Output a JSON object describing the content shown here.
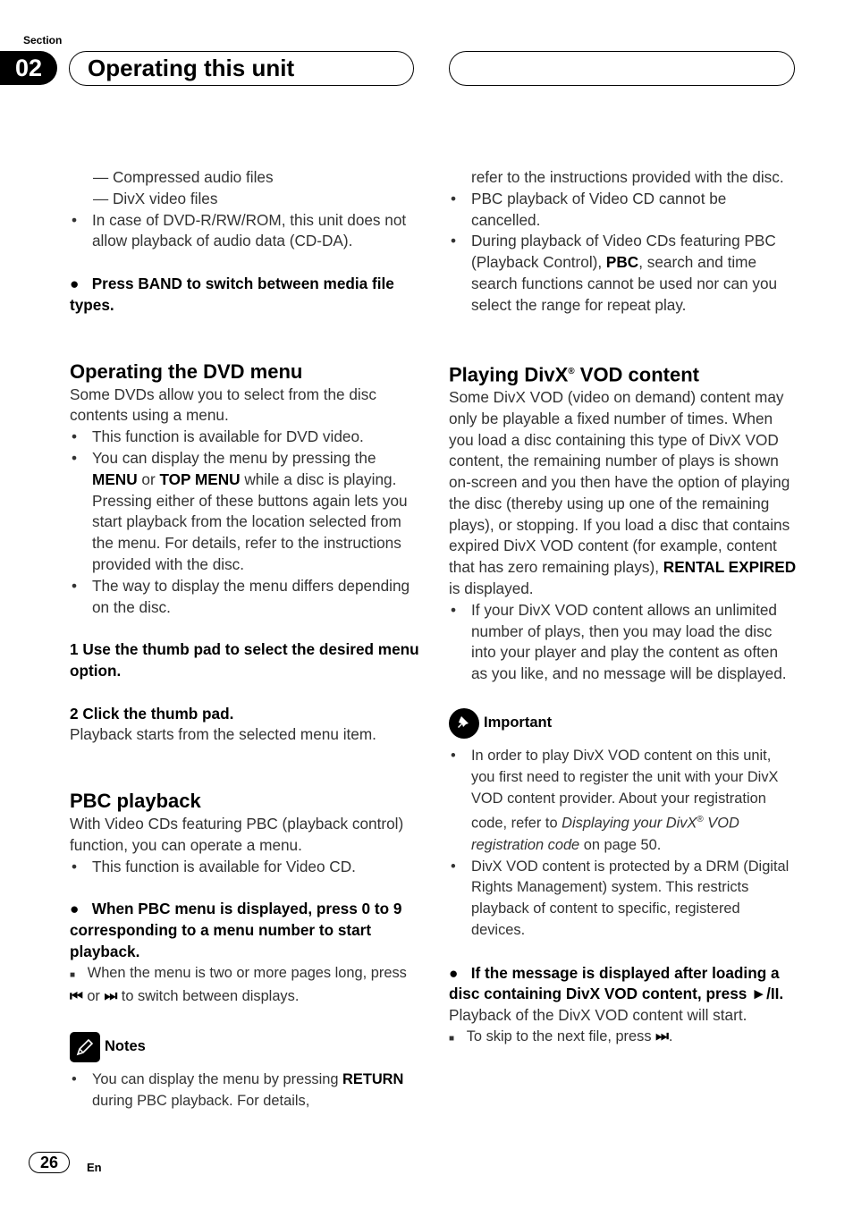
{
  "header": {
    "section_label": "Section",
    "section_number": "02",
    "title": "Operating this unit"
  },
  "left": {
    "dash_items": [
      "Compressed audio files",
      "DivX video files"
    ],
    "bullet_dvd": "In case of DVD-R/RW/ROM, this unit does not allow playback of audio data (CD-DA).",
    "press_band": "Press BAND to switch between media file types.",
    "dvd_menu": {
      "heading": "Operating the DVD menu",
      "intro": "Some DVDs allow you to select from the disc contents using a menu.",
      "bullet1": "This function is available for DVD video.",
      "bullet2_pre": "You can display the menu by pressing the ",
      "bullet2_menu": "MENU",
      "bullet2_or": " or ",
      "bullet2_top": "TOP MENU",
      "bullet2_post": " while a disc is playing. Pressing either of these buttons again lets you start playback from the location selected from the menu. For details, refer to the instructions provided with the disc.",
      "bullet3": "The way to display the menu differs depending on the disc.",
      "step1": "1    Use the thumb pad to select the desired menu option.",
      "step2": "2    Click the thumb pad.",
      "step2_desc": "Playback starts from the selected menu item."
    },
    "pbc": {
      "heading": "PBC playback",
      "intro": "With Video CDs featuring PBC (playback control) function, you can operate a menu.",
      "bullet1": "This function is available for Video CD.",
      "step": "When PBC menu is displayed, press 0 to 9 corresponding to a menu number to start playback.",
      "note_pre": "When the menu is two or more pages long, press ",
      "note_prev": "⏮",
      "note_or": " or ",
      "note_next": "⏭",
      "note_post": " to switch between displays."
    },
    "notes": {
      "label": "Notes",
      "item_pre": "You can display the menu by pressing ",
      "item_bold": "RETURN",
      "item_post": " during PBC playback. For details,"
    }
  },
  "right": {
    "cont1": "refer to the instructions provided with the disc.",
    "bullet_pbc_cancel": "PBC playback of Video CD cannot be cancelled.",
    "bullet_pbc_pre": "During playback of Video CDs featuring PBC (Playback Control), ",
    "bullet_pbc_bold": "PBC",
    "bullet_pbc_post": ", search and time search functions cannot be used nor can you select the range for repeat play.",
    "divx": {
      "heading_pre": "Playing DivX",
      "heading_reg": "®",
      "heading_post": " VOD content",
      "para_pre": "Some DivX VOD (video on demand) content may only be playable a fixed number of times. When you load a disc containing this type of DivX VOD content, the remaining number of plays is shown on-screen and you then have the option of playing the disc (thereby using up one of the remaining plays), or stopping. If you load a disc that contains expired DivX VOD content (for example, content that has zero remaining plays), ",
      "para_bold": "RENTAL EXPIRED",
      "para_post": " is displayed.",
      "bullet": "If your DivX VOD content allows an unlimited number of plays, then you may load the disc into your player and play the content as often as you like, and no message will be displayed."
    },
    "important": {
      "label": "Important",
      "item1_pre": "In order to play DivX VOD content on this unit, you first need to register the unit with your DivX VOD content provider. About your registration code, refer to ",
      "item1_italic": "Displaying your DivX",
      "item1_reg": "®",
      "item1_italic2": " VOD registration code",
      "item1_post": " on page 50.",
      "item2": "DivX VOD content is protected by a DRM (Digital Rights Management) system. This restricts playback of content to specific, registered devices."
    },
    "step": "If the message is displayed after loading a disc containing DivX VOD content, press ►/II.",
    "step_desc": "Playback of the DivX VOD content will start.",
    "skip_pre": "To skip to the next file, press ",
    "skip_icon": "⏭",
    "skip_post": "."
  },
  "footer": {
    "page_number": "26",
    "language": "En"
  }
}
